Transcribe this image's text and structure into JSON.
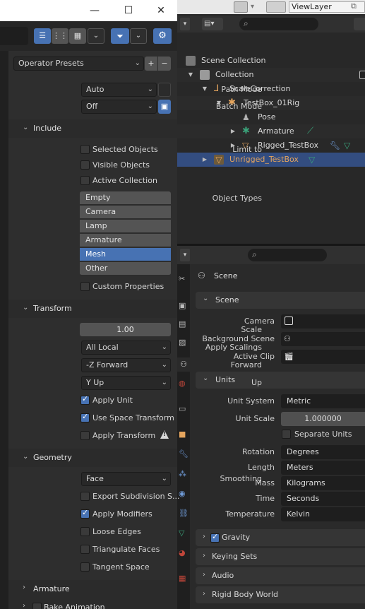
{
  "dialog": {
    "window_buttons": {
      "minimize": "—",
      "maximize": "☐",
      "close": "✕"
    },
    "presets": {
      "label": "Operator Presets",
      "add": "+",
      "remove": "−"
    },
    "path_mode": {
      "label": "Path Mode",
      "value": "Auto"
    },
    "batch_mode": {
      "label": "Batch Mode",
      "value": "Off"
    },
    "include": {
      "title": "Include",
      "limit_to_label": "Limit to",
      "limit_options": [
        {
          "label": "Selected Objects",
          "checked": false
        },
        {
          "label": "Visible Objects",
          "checked": false
        },
        {
          "label": "Active Collection",
          "checked": false
        }
      ],
      "object_types_label": "Object Types",
      "object_types": [
        {
          "label": "Empty",
          "active": false
        },
        {
          "label": "Camera",
          "active": false
        },
        {
          "label": "Lamp",
          "active": false
        },
        {
          "label": "Armature",
          "active": false
        },
        {
          "label": "Mesh",
          "active": true
        },
        {
          "label": "Other",
          "active": false
        }
      ],
      "custom_properties": {
        "label": "Custom Properties",
        "checked": false
      }
    },
    "transform": {
      "title": "Transform",
      "scale_label": "Scale",
      "scale_value": "1.00",
      "apply_scalings_label": "Apply Scalings",
      "apply_scalings_value": "All Local",
      "forward_label": "Forward",
      "forward_value": "-Z Forward",
      "up_label": "Up",
      "up_value": "Y Up",
      "apply_unit": {
        "label": "Apply Unit",
        "checked": true
      },
      "use_space_transform": {
        "label": "Use Space Transform",
        "checked": true
      },
      "apply_transform": {
        "label": "Apply Transform",
        "checked": false,
        "warning": "!"
      }
    },
    "geometry": {
      "title": "Geometry",
      "smoothing_label": "Smoothing",
      "smoothing_value": "Face",
      "export_subdivision": {
        "label": "Export Subdivision S...",
        "checked": false
      },
      "apply_modifiers": {
        "label": "Apply Modifiers",
        "checked": true
      },
      "loose_edges": {
        "label": "Loose Edges",
        "checked": false
      },
      "triangulate_faces": {
        "label": "Triangulate Faces",
        "checked": false
      },
      "tangent_space": {
        "label": "Tangent Space",
        "checked": false
      }
    },
    "armature": {
      "title": "Armature"
    },
    "bake_animation": {
      "title": "Bake Animation"
    }
  },
  "outliner": {
    "view_layer": "ViewLayer",
    "rows": [
      {
        "label": "Scene Collection",
        "icon": "scene-collection-icon"
      },
      {
        "label": "Collection",
        "icon": "collection-icon"
      },
      {
        "label": "ScaleCorrection",
        "icon": "empty-axes-icon"
      },
      {
        "label": "TestBox_01Rig",
        "icon": "armature-object-icon"
      },
      {
        "label": "Pose",
        "icon": "pose-icon"
      },
      {
        "label": "Armature",
        "icon": "armature-data-icon"
      },
      {
        "label": "Rigged_TestBox",
        "icon": "mesh-object-icon"
      },
      {
        "label": "Unrigged_TestBox",
        "icon": "mesh-object-icon"
      }
    ]
  },
  "properties": {
    "context": "Scene",
    "scene_section": {
      "title": "Scene",
      "camera_label": "Camera",
      "background_scene_label": "Background Scene",
      "active_clip_label": "Active Clip"
    },
    "units_section": {
      "title": "Units",
      "unit_system_label": "Unit System",
      "unit_system_value": "Metric",
      "unit_scale_label": "Unit Scale",
      "unit_scale_value": "1.000000",
      "separate_units": {
        "label": "Separate Units",
        "checked": false
      },
      "rotation_label": "Rotation",
      "rotation_value": "Degrees",
      "length_label": "Length",
      "length_value": "Meters",
      "mass_label": "Mass",
      "mass_value": "Kilograms",
      "time_label": "Time",
      "time_value": "Seconds",
      "temperature_label": "Temperature",
      "temperature_value": "Kelvin"
    },
    "collapsed_sections": [
      "Gravity",
      "Keying Sets",
      "Audio",
      "Rigid Body World"
    ],
    "gravity_checked": true
  },
  "colors": {
    "accent": "#4772b3",
    "selected_row": "#334d80",
    "orange_text": "#e5a55e",
    "armature_green": "#3aa37a"
  }
}
